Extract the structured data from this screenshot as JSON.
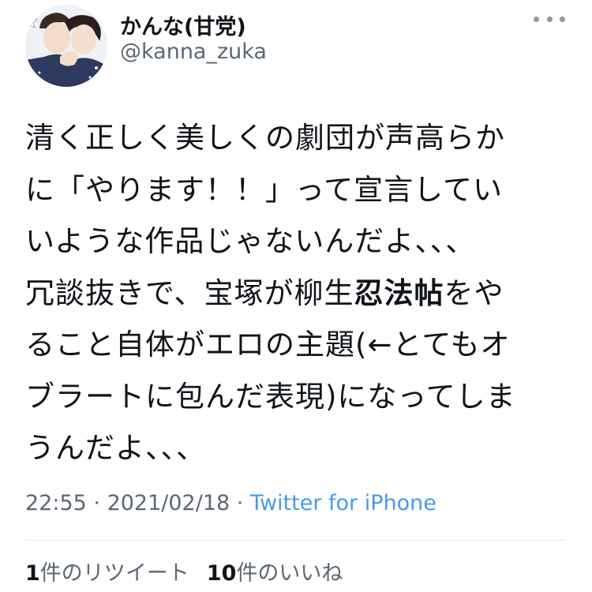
{
  "author": {
    "name": "かんな(甘党)",
    "handle": "@kanna_zuka"
  },
  "tweet": {
    "lines": [
      "清く正しく美しくの劇団が声高らか",
      "に「やります！！」って宣言してい",
      "いような作品じゃないんだよ、、、",
      {
        "before": "冗談抜きで、宝塚が柳生",
        "bold": "忍法帖",
        "after": "をや"
      },
      "ること自体がエロの主題(←とてもオ",
      "ブラートに包んだ表現)になってしま",
      "うんだよ、、、"
    ]
  },
  "meta": {
    "time": "22:55",
    "separator": " · ",
    "date": "2021/02/18",
    "source": "Twitter for iPhone"
  },
  "stats": {
    "retweets_count": "1",
    "retweets_label": "件のリツイート",
    "likes_count": "10",
    "likes_label": "件のいいね"
  },
  "icons": {
    "more": "more-dots-icon"
  }
}
